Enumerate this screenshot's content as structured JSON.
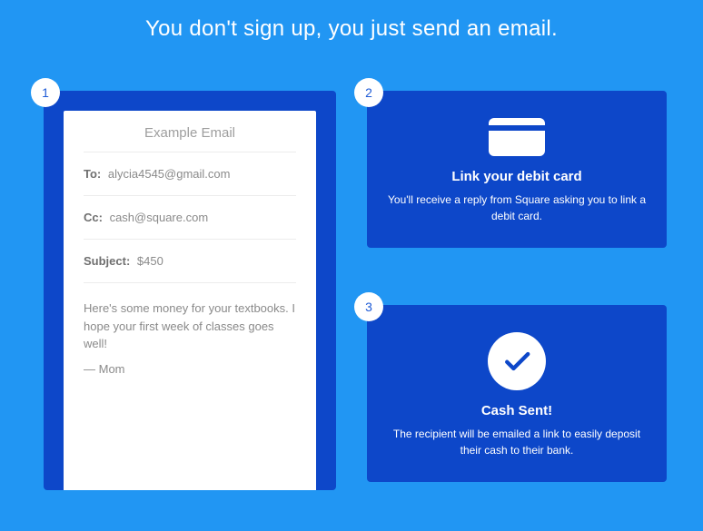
{
  "headline": "You don't sign up, you just send an email.",
  "steps": {
    "one": {
      "num": "1",
      "email": {
        "title": "Example Email",
        "to_label": "To:",
        "to_value": "alycia4545@gmail.com",
        "cc_label": "Cc:",
        "cc_value": "cash@square.com",
        "subject_label": "Subject:",
        "subject_value": "$450",
        "body": "Here's some money for your textbooks. I hope your first week of classes goes well!",
        "signature": "— Mom"
      }
    },
    "two": {
      "num": "2",
      "title": "Link your debit card",
      "desc": "You'll receive a reply from Square asking you to link a debit card."
    },
    "three": {
      "num": "3",
      "title": "Cash Sent!",
      "desc": "The recipient will be emailed a link to easily deposit their cash to their bank."
    }
  }
}
